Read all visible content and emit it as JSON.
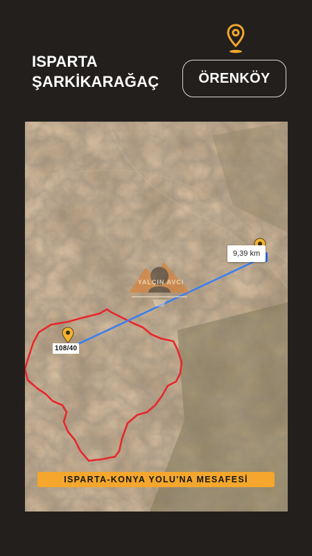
{
  "header": {
    "line1": "ISPARTA",
    "line2": "ŞARKİKARAĞAÇ",
    "location_button": "ÖRENKÖY",
    "pin_icon": "map-pin-icon",
    "accent_color": "#f4a72c"
  },
  "map": {
    "distance_label": "9,39 km",
    "parcel_label": "108/40",
    "watermark_text": "YALÇIN AVCI",
    "boundary_color": "#e8262b",
    "route_color": "#3b7ff0",
    "pin_color": "#f2b32e"
  },
  "banner": {
    "text": "ISPARTA-KONYA YOLU'NA MESAFESİ"
  }
}
